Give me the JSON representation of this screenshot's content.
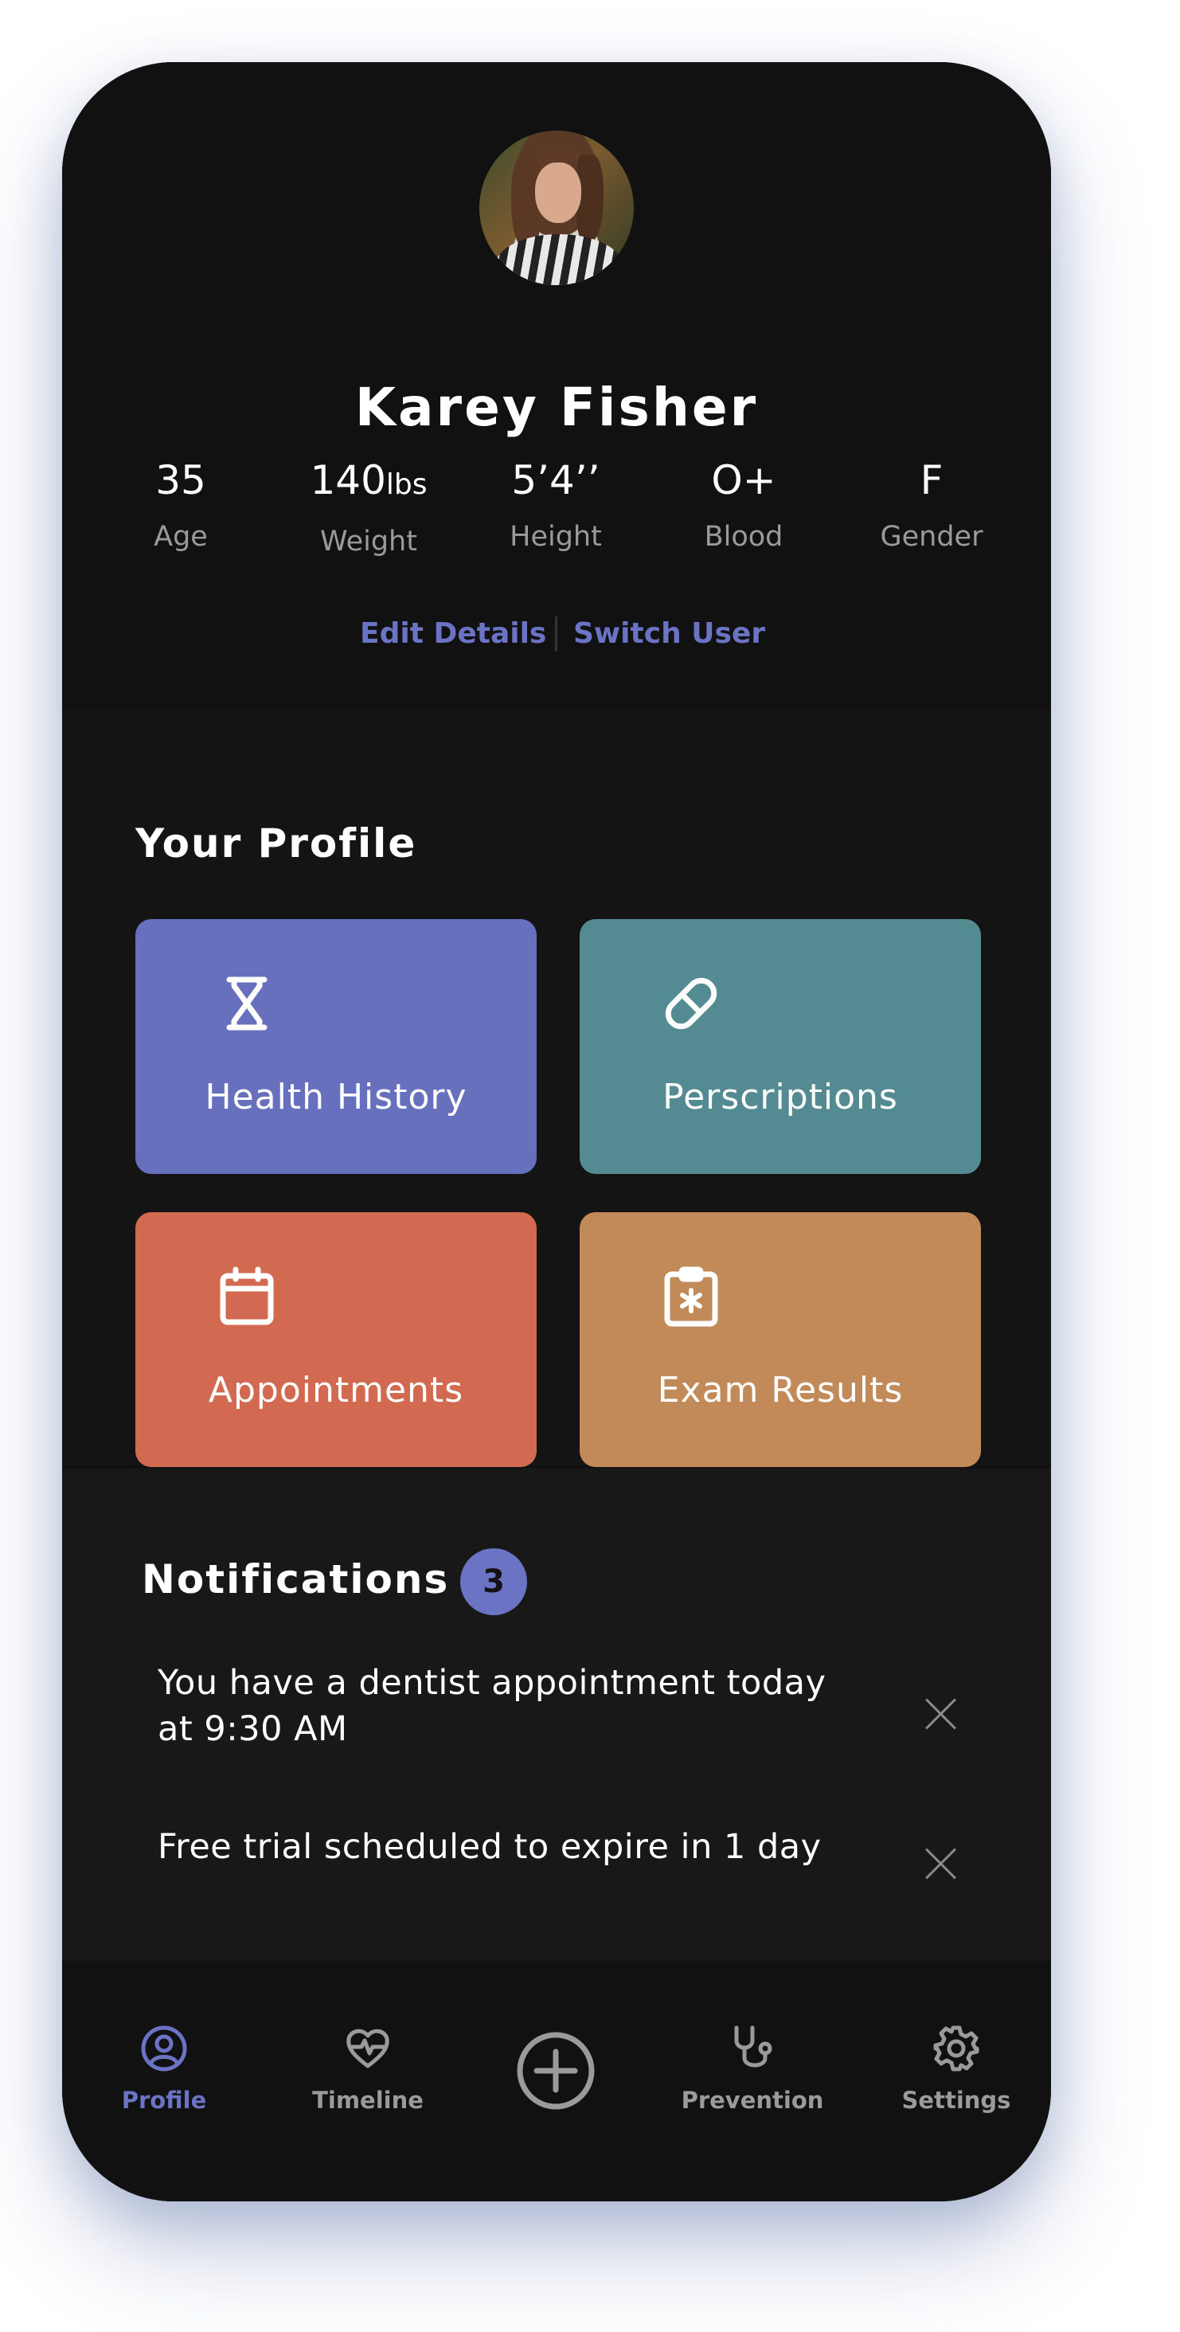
{
  "user": {
    "name": "Karey Fisher",
    "avatar": "profile-photo"
  },
  "stats": [
    {
      "value": "35",
      "unit": "",
      "label": "Age"
    },
    {
      "value": "140",
      "unit": "lbs",
      "label": "Weight"
    },
    {
      "value": "5’4’’",
      "unit": "",
      "label": "Height"
    },
    {
      "value": "O+",
      "unit": "",
      "label": "Blood"
    },
    {
      "value": "F",
      "unit": "",
      "label": "Gender"
    }
  ],
  "header_links": {
    "edit": "Edit Details",
    "switch": "Switch User"
  },
  "profile": {
    "title": "Your Profile",
    "tiles": [
      {
        "label": "Health History",
        "icon": "hourglass-icon",
        "color": "#6670bd"
      },
      {
        "label": "Perscriptions",
        "icon": "pill-icon",
        "color": "#548a91"
      },
      {
        "label": "Appointments",
        "icon": "calendar-icon",
        "color": "#d16a50"
      },
      {
        "label": "Exam Results",
        "icon": "clipboard-medical-icon",
        "color": "#c28a58"
      }
    ]
  },
  "notifications": {
    "title": "Notifications",
    "count": "3",
    "items": [
      {
        "line1": "You have a dentist appointment today",
        "line2": "at 9:30 AM"
      },
      {
        "line1": "Free trial scheduled to expire in 1 day",
        "line2": ""
      }
    ]
  },
  "nav": {
    "items": [
      {
        "label": "Profile",
        "icon": "user-circle-icon",
        "active": true
      },
      {
        "label": "Timeline",
        "icon": "heart-pulse-icon",
        "active": false
      },
      {
        "label": "",
        "icon": "plus-circle-icon",
        "active": false
      },
      {
        "label": "Prevention",
        "icon": "stethoscope-icon",
        "active": false
      },
      {
        "label": "Settings",
        "icon": "gear-icon",
        "active": false
      }
    ]
  },
  "colors": {
    "accent": "#6a73c4",
    "background": "#111111"
  }
}
